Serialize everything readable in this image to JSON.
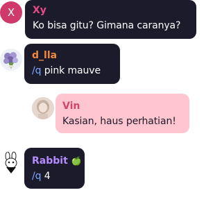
{
  "messages": [
    {
      "sender": "Xy",
      "text": "Ko bisa gitu? Gimana caranya?",
      "avatar_letter": "X",
      "avatar_color": "#d03a6a",
      "name_color": "#e84a86",
      "bubble_color": "#1c1b2b"
    },
    {
      "sender": "d_lla",
      "command": "/q",
      "text": "pink mauve",
      "avatar_icon": "flower-bouquet-icon",
      "name_color": "#f08a3c",
      "command_color": "#7aa6ff",
      "bubble_color": "#1c1b2b"
    },
    {
      "sender": "Vin",
      "text": "Kasian, haus perhatian!",
      "avatar_icon": "girl-photo-icon",
      "name_color": "#d1456b",
      "bubble_color": "#ffc6cf"
    },
    {
      "sender": "Rabbit",
      "sender_emoji": "🍏",
      "command": "/q",
      "text": "4",
      "avatar_icon": "rabbit-sticker-icon",
      "name_color": "#b48cff",
      "command_color": "#7aa6ff",
      "bubble_color": "#1c1b2b"
    }
  ]
}
